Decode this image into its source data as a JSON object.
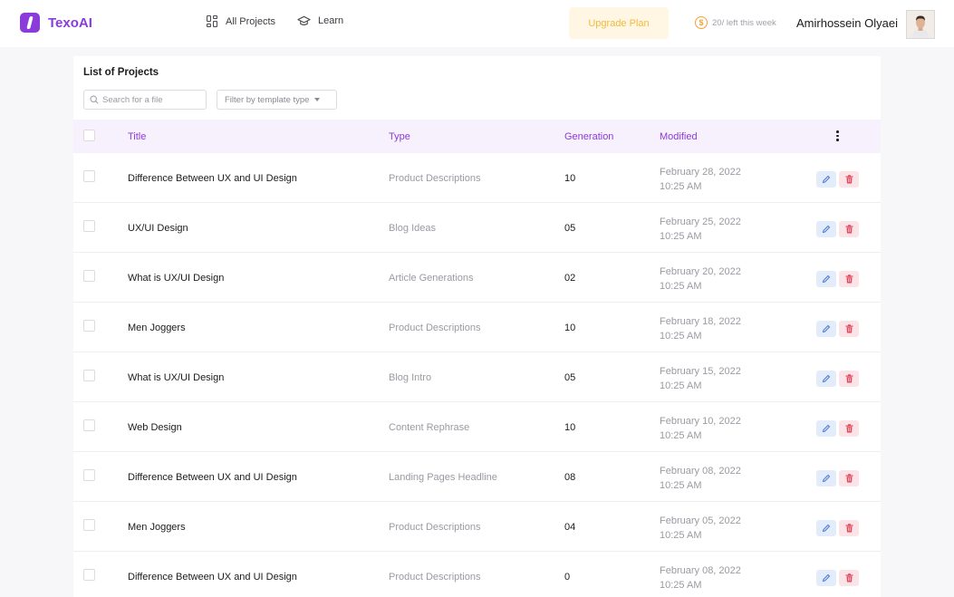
{
  "app": {
    "name": "TexoAI",
    "brand_color": "#8b3bd9"
  },
  "nav": {
    "all_projects": "All Projects",
    "learn": "Learn",
    "upgrade": "Upgrade Plan",
    "credits": "20/ left this week",
    "coin_symbol": "$",
    "user_name": "Amirhossein Olyaei"
  },
  "projects": {
    "title": "List of Projects",
    "search_placeholder": "Search for a file",
    "filter_label": "Filter by template type",
    "columns": {
      "title": "Title",
      "type": "Type",
      "generation": "Generation",
      "modified": "Modified"
    },
    "rows": [
      {
        "title": "Difference Between UX and UI Design",
        "type": "Product Descriptions",
        "generation": "10",
        "date": "February 28, 2022",
        "time": "10:25 AM"
      },
      {
        "title": "UX/UI Design",
        "type": "Blog Ideas",
        "generation": "05",
        "date": "February 25, 2022",
        "time": "10:25 AM"
      },
      {
        "title": "What is UX/UI Design",
        "type": "Article Generations",
        "generation": "02",
        "date": "February 20, 2022",
        "time": "10:25 AM"
      },
      {
        "title": "Men Joggers",
        "type": "Product Descriptions",
        "generation": "10",
        "date": "February 18, 2022",
        "time": "10:25 AM"
      },
      {
        "title": "What is UX/UI Design",
        "type": "Blog Intro",
        "generation": "05",
        "date": "February 15, 2022",
        "time": "10:25 AM"
      },
      {
        "title": "Web Design",
        "type": "Content Rephrase",
        "generation": "10",
        "date": "February 10, 2022",
        "time": "10:25 AM"
      },
      {
        "title": "Difference Between UX and UI Design",
        "type": "Landing Pages Headline",
        "generation": "08",
        "date": "February 08, 2022",
        "time": "10:25 AM"
      },
      {
        "title": "Men Joggers",
        "type": "Product Descriptions",
        "generation": "04",
        "date": "February 05, 2022",
        "time": "10:25 AM"
      },
      {
        "title": "Difference Between UX and UI Design",
        "type": "Product Descriptions",
        "generation": "0",
        "date": "February 08, 2022",
        "time": "10:25 AM"
      }
    ]
  },
  "icons": [
    "logo-icon",
    "grid-icon",
    "graduation-cap-icon",
    "coin-icon",
    "search-icon",
    "chevron-down-icon",
    "more-vertical-icon",
    "pencil-icon",
    "trash-icon"
  ]
}
